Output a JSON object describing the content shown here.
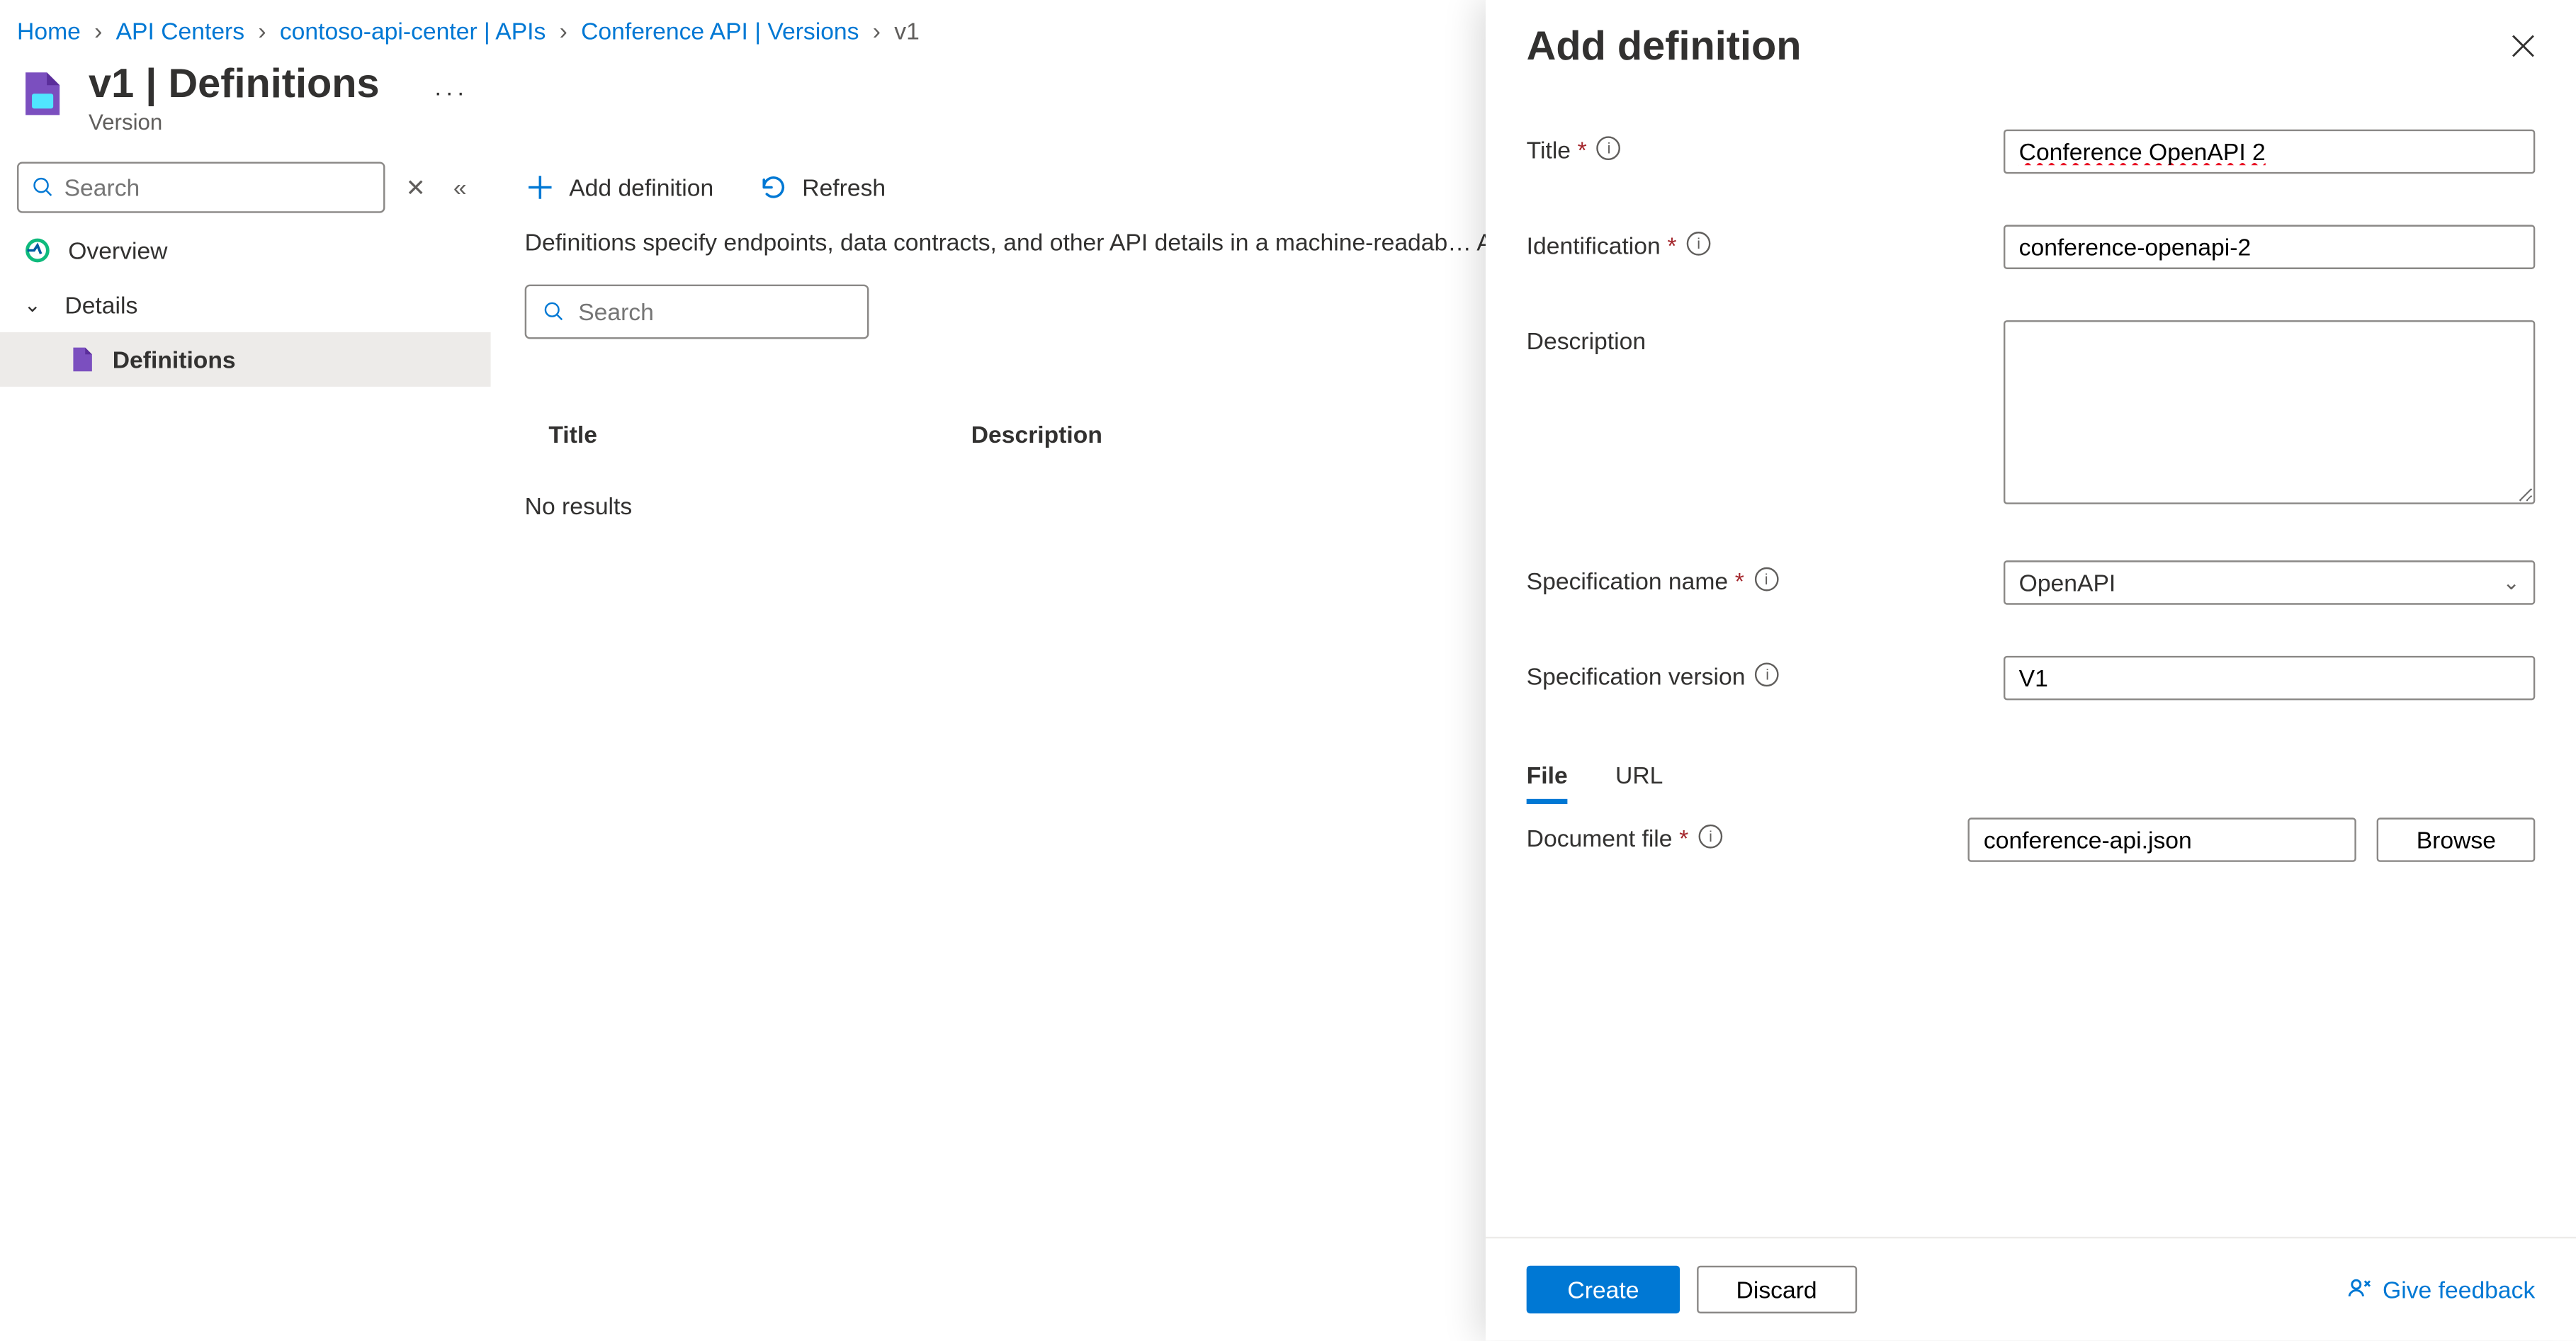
{
  "breadcrumbs": {
    "items": [
      "Home",
      "API Centers",
      "contoso-api-center | APIs",
      "Conference API | Versions",
      "v1"
    ]
  },
  "header": {
    "title": "v1 | Definitions",
    "subtitle": "Version"
  },
  "sidebar": {
    "search_placeholder": "Search",
    "items": {
      "overview": "Overview",
      "details": "Details",
      "definitions": "Definitions"
    }
  },
  "toolbar": {
    "add": "Add definition",
    "refresh": "Refresh"
  },
  "main": {
    "description": "Definitions specify endpoints, data contracts, and other API details in a machine-readab… AsyncAPI specifications.",
    "search_placeholder": "Search",
    "columns": {
      "title": "Title",
      "description": "Description"
    },
    "no_results": "No results"
  },
  "panel": {
    "title": "Add definition",
    "fields": {
      "title_label": "Title",
      "title_value": "Conference OpenAPI 2",
      "identification_label": "Identification",
      "identification_value": "conference-openapi-2",
      "description_label": "Description",
      "description_value": "",
      "spec_name_label": "Specification name",
      "spec_name_value": "OpenAPI",
      "spec_version_label": "Specification version",
      "spec_version_value": "V1",
      "document_file_label": "Document file",
      "document_file_value": "conference-api.json"
    },
    "tabs": {
      "file": "File",
      "url": "URL"
    },
    "browse": "Browse",
    "create": "Create",
    "discard": "Discard",
    "feedback": "Give feedback"
  }
}
